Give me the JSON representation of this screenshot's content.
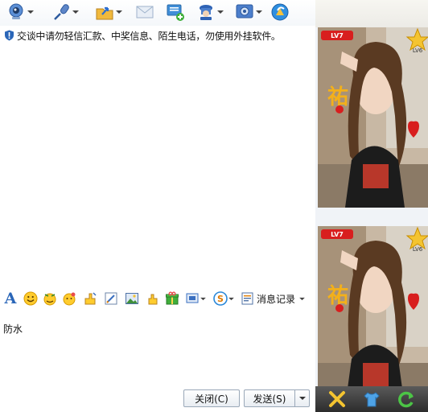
{
  "toolbar": {
    "items": [
      {
        "icon": "webcam-icon"
      },
      {
        "icon": "microphone-icon"
      },
      {
        "icon": "send-file-icon"
      },
      {
        "icon": "email-icon"
      },
      {
        "icon": "add-group-chat-icon"
      },
      {
        "icon": "remote-assist-icon"
      },
      {
        "icon": "settings-icon"
      },
      {
        "icon": "app-share-icon"
      }
    ]
  },
  "notice": {
    "text": "交谈中请勿轻信汇款、中奖信息、陌生电话，勿使用外挂软件。",
    "icon": "security-shield-icon"
  },
  "format_toolbar": {
    "font_label": "A",
    "icons": [
      "font-icon",
      "emoji-icon",
      "wink-emoji-icon",
      "magic-emoji-icon",
      "nudge-icon",
      "handwriting-icon",
      "picture-icon",
      "gesture-icon",
      "gift-icon",
      "screenshot-icon",
      "music-icon"
    ],
    "history_label": "消息记录"
  },
  "input": {
    "text": "防水"
  },
  "buttons": {
    "close_label": "关闭(C)",
    "send_label": "发送(S)"
  },
  "side_panel": {
    "avatar_badge": "LV7",
    "star_badge": "LV6",
    "bottom_icons": [
      "tools-icon",
      "clothes-icon",
      "refresh-icon"
    ]
  },
  "colors": {
    "accent": "#2a66b8",
    "side_bottom_bar": "#3a3a3a",
    "badge_red": "#d81e1e",
    "star_gold": "#f4c430"
  }
}
